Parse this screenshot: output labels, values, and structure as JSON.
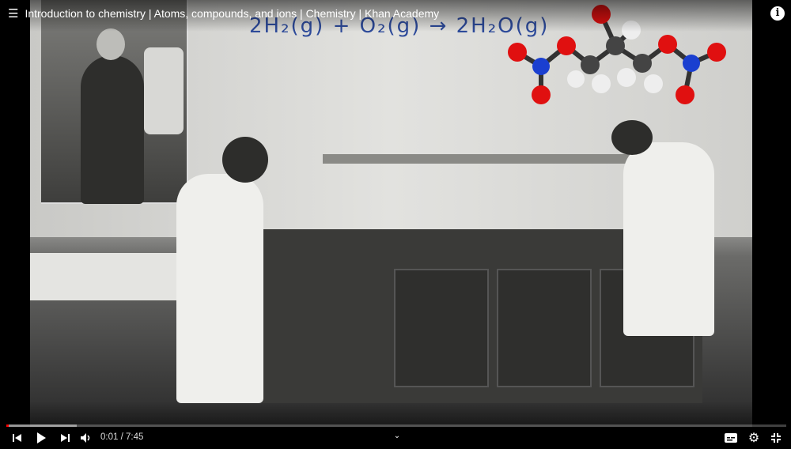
{
  "video": {
    "title": "Introduction to chemistry | Atoms, compounds, and ions | Chemistry | Khan Academy",
    "equation": "2H₂(g) + O₂(g) → 2H₂O(g)"
  },
  "player": {
    "current_time": "0:01",
    "separator": " / ",
    "duration": "7:45",
    "progress_fraction": 0.002,
    "buffered_fraction": 0.09,
    "accent_color": "#ff0000"
  },
  "icons": [
    "playlist-icon",
    "info-icon",
    "previous-icon",
    "play-icon",
    "next-icon",
    "volume-icon",
    "chevron-down-icon",
    "subtitles-icon",
    "settings-icon",
    "exit-fullscreen-icon"
  ]
}
